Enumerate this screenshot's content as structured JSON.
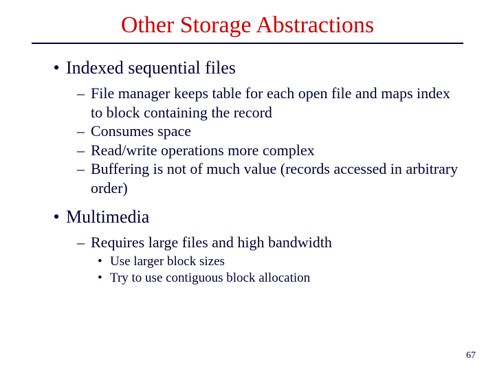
{
  "title": "Other Storage Abstractions",
  "sections": [
    {
      "heading": "Indexed sequential files",
      "subitems": [
        "File manager keeps table for each open file and maps index to block containing the record",
        "Consumes space",
        "Read/write operations more complex",
        "Buffering is not of much value (records accessed in arbitrary order)"
      ]
    },
    {
      "heading": "Multimedia",
      "subitems": [
        "Requires large files and high bandwidth"
      ],
      "subsubitems": [
        "Use larger block sizes",
        "Try to use contiguous block allocation"
      ]
    }
  ],
  "pageNumber": "67"
}
